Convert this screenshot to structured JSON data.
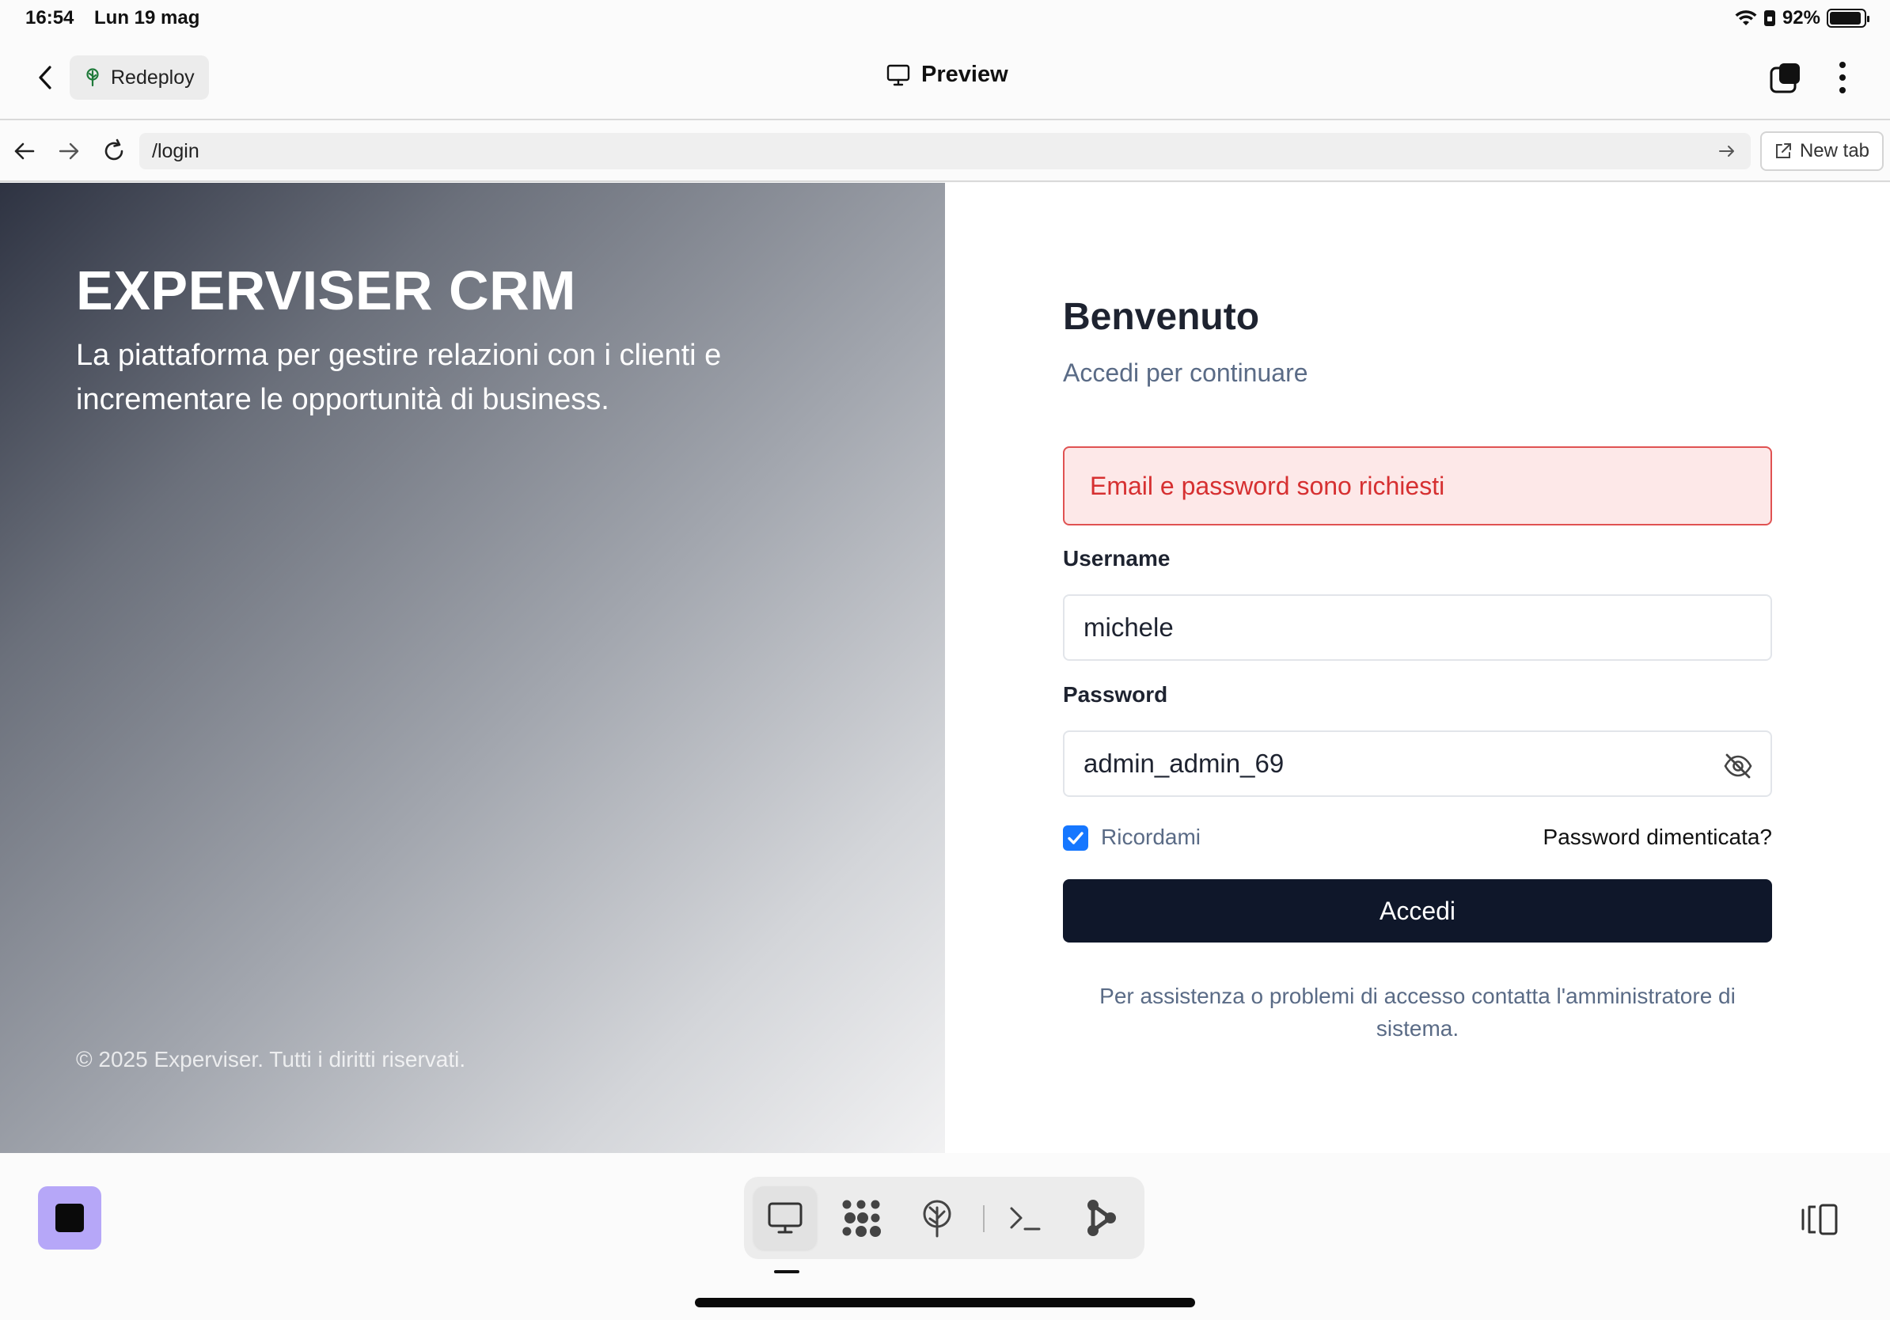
{
  "status_bar": {
    "time": "16:54",
    "date": "Lun 19 mag",
    "battery_percent_label": "92%",
    "battery_level": 0.92
  },
  "header": {
    "redeploy_label": "Redeploy",
    "title": "Preview"
  },
  "browser": {
    "url": "/login",
    "new_tab_label": "New tab"
  },
  "hero": {
    "title": "EXPERVISER CRM",
    "subtitle": "La piattaforma per gestire relazioni con i clienti e incrementare le opportunità di business.",
    "copyright": "© 2025 Experviser. Tutti i diritti riservati."
  },
  "login": {
    "title": "Benvenuto",
    "subtitle": "Accedi per continuare",
    "error": "Email e password sono richiesti",
    "username_label": "Username",
    "username_value": "michele",
    "password_label": "Password",
    "password_value": "admin_admin_69",
    "remember_label": "Ricordami",
    "remember_checked": true,
    "forgot_label": "Password dimenticata?",
    "submit_label": "Accedi",
    "help_text": "Per assistenza o problemi di accesso contatta l'amministratore di sistema."
  },
  "colors": {
    "primary_button": "#0f172a",
    "error_text": "#d63031",
    "error_bg": "#fde8e8",
    "checkbox": "#1677ff",
    "stop_button": "#b6a7f8"
  },
  "dock": {
    "items": [
      "monitor-icon",
      "apps-grid-icon",
      "deploy-icon",
      "terminal-icon",
      "share-graph-icon"
    ],
    "active": "monitor-icon"
  }
}
